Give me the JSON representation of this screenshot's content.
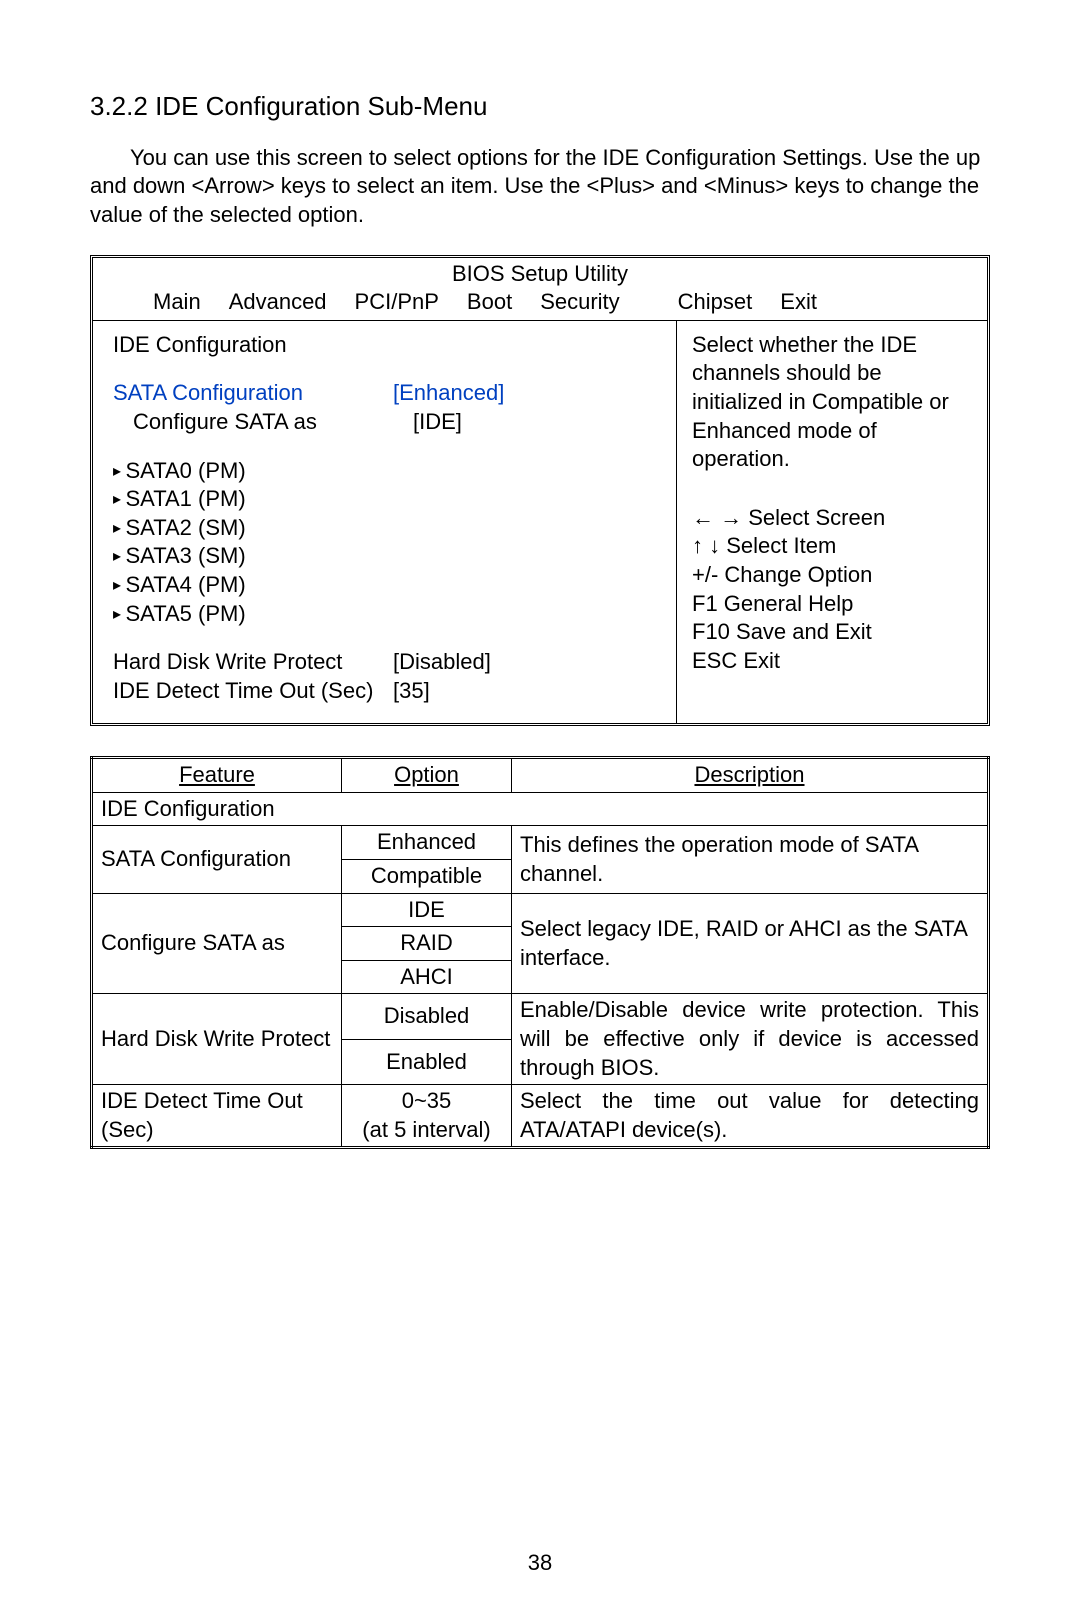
{
  "section_number": "3.2.2",
  "section_title": "IDE Configuration Sub-Menu",
  "intro_text": "You can use this screen to select options for the IDE Configuration Settings. Use the up and down <Arrow> keys to select an item. Use the <Plus> and <Minus> keys to change the value of the selected option.",
  "bios": {
    "window_title": "BIOS Setup Utility",
    "menu": [
      "Main",
      "Advanced",
      "PCI/PnP",
      "Boot",
      "Security",
      "Chipset",
      "Exit"
    ],
    "left_heading": "IDE Configuration",
    "items": {
      "sata_config_label": "SATA Configuration",
      "sata_config_value": "[Enhanced]",
      "configure_sata_label": "Configure SATA as",
      "configure_sata_value": "[IDE]",
      "ports": [
        "SATA0 (PM)",
        "SATA1 (PM)",
        "SATA2 (SM)",
        "SATA3 (SM)",
        "SATA4 (PM)",
        "SATA5 (PM)"
      ],
      "hd_write_protect_label": "Hard Disk Write Protect",
      "hd_write_protect_value": "[Disabled]",
      "ide_detect_label": "IDE Detect Time Out (Sec)",
      "ide_detect_value": "[35]"
    },
    "help_text": "Select whether the IDE channels should be initialized in Compatible or Enhanced mode of operation.",
    "keys": {
      "lr": "← → Select Screen",
      "ud": "↑ ↓  Select Item",
      "pm": "+/-    Change Option",
      "f1": "F1     General Help",
      "f10": "F10   Save and Exit",
      "esc": "ESC  Exit"
    }
  },
  "table": {
    "headers": {
      "feature": "Feature",
      "option": "Option",
      "description": "Description"
    },
    "ide_config_row": "IDE Configuration",
    "rows": [
      {
        "feature": "SATA Configuration",
        "options": [
          "Enhanced",
          "Compatible"
        ],
        "description": "This defines the operation mode of SATA channel."
      },
      {
        "feature": "Configure SATA as",
        "options": [
          "IDE",
          "RAID",
          "AHCI"
        ],
        "description": "Select legacy IDE, RAID or AHCI as the SATA interface."
      },
      {
        "feature": "Hard Disk Write Protect",
        "options": [
          "Disabled",
          "Enabled"
        ],
        "description": "Enable/Disable device write protection. This will be effective only if device is accessed through BIOS."
      },
      {
        "feature": "IDE Detect Time Out (Sec)",
        "options": [
          "0~35",
          "(at 5 interval)"
        ],
        "description": "Select the time out value for detecting ATA/ATAPI device(s)."
      }
    ]
  },
  "page_number": "38"
}
